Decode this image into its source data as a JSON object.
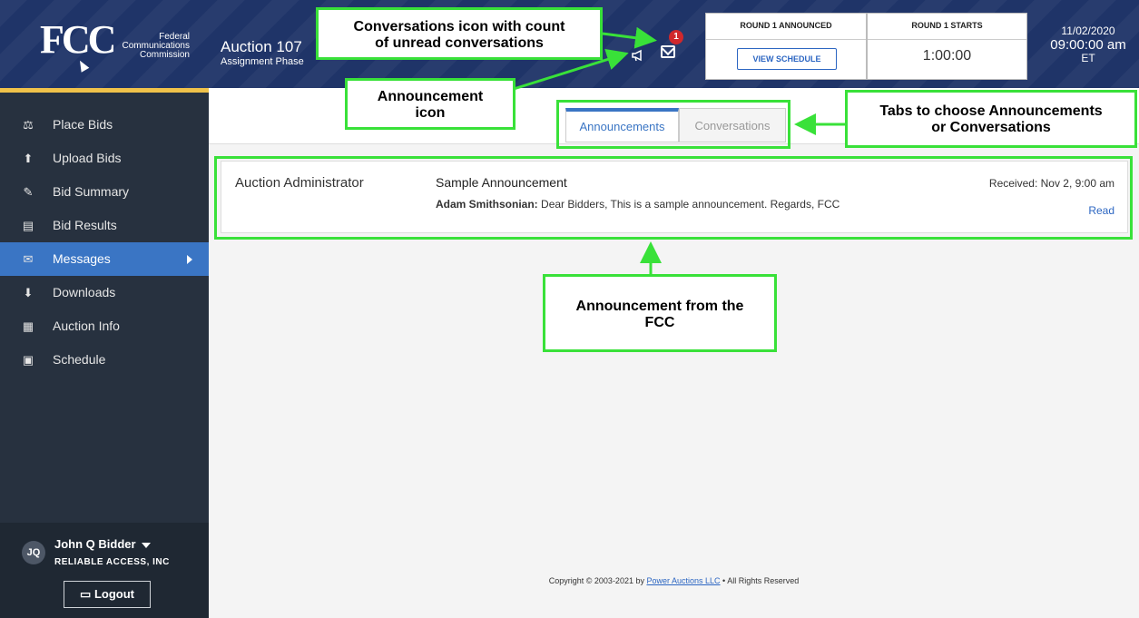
{
  "header": {
    "agency_line1": "Federal",
    "agency_line2": "Communications",
    "agency_line3": "Commission",
    "logo_text": "FCC",
    "auction_title": "Auction 107",
    "auction_phase": "Assignment Phase",
    "unread_conversations": "1",
    "round_announced_label": "ROUND 1 ANNOUNCED",
    "view_schedule_label": "VIEW SCHEDULE",
    "round_starts_label": "ROUND 1 STARTS",
    "round_countdown": "1:00:00",
    "date": "11/02/2020",
    "time": "09:00:00 am",
    "timezone": "ET"
  },
  "sidebar": {
    "items": [
      {
        "label": "Place Bids",
        "icon": "gavel-icon"
      },
      {
        "label": "Upload Bids",
        "icon": "upload-file-icon"
      },
      {
        "label": "Bid Summary",
        "icon": "summary-icon"
      },
      {
        "label": "Bid Results",
        "icon": "results-icon"
      },
      {
        "label": "Messages",
        "icon": "envelope-icon"
      },
      {
        "label": "Downloads",
        "icon": "download-icon"
      },
      {
        "label": "Auction Info",
        "icon": "clipboard-icon"
      },
      {
        "label": "Schedule",
        "icon": "calendar-icon"
      }
    ],
    "user": {
      "initials": "JQ",
      "name": "John Q Bidder",
      "company": "RELIABLE ACCESS, INC",
      "logout_label": "Logout"
    }
  },
  "tabs": {
    "announcements": "Announcements",
    "conversations": "Conversations"
  },
  "announcement": {
    "from": "Auction Administrator",
    "subject": "Sample Announcement",
    "author": "Adam Smithsonian:",
    "body": "Dear Bidders, This is a sample announcement. Regards, FCC",
    "received": "Received: Nov 2, 9:00 am",
    "read_label": "Read"
  },
  "footer": {
    "prefix": "Copyright © 2003-2021 by",
    "link": "Power Auctions LLC",
    "suffix": "• All Rights Reserved"
  },
  "callouts": {
    "conversations_line1": "Conversations icon with count",
    "conversations_line2": "of unread conversations",
    "announcement_icon_line1": "Announcement",
    "announcement_icon_line2": "icon",
    "tabs_line1": "Tabs to choose Announcements",
    "tabs_line2": "or Conversations",
    "announcement_line1": "Announcement from the",
    "announcement_line2": "FCC"
  },
  "colors": {
    "header_bg": "#1f3468",
    "sidebar_bg": "#27313f",
    "active_nav": "#3a75c4",
    "accent_gold": "#f0c24a",
    "callout_green": "#39e139",
    "badge_red": "#d0282c"
  }
}
